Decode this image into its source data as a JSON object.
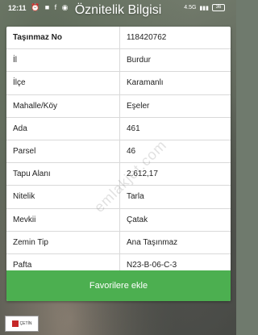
{
  "status_bar": {
    "time": "12:11",
    "icons": "⏰ ■ f ◉",
    "network": "4.5G",
    "battery": "36"
  },
  "header": {
    "title": "Öznitelik Bilgisi"
  },
  "attributes": [
    {
      "key": "Taşınmaz No",
      "value": "118420762"
    },
    {
      "key": "İl",
      "value": "Burdur"
    },
    {
      "key": "İlçe",
      "value": "Karamanlı"
    },
    {
      "key": "Mahalle/Köy",
      "value": "Eşeler"
    },
    {
      "key": "Ada",
      "value": "461"
    },
    {
      "key": "Parsel",
      "value": "46"
    },
    {
      "key": "Tapu Alanı",
      "value": "2.612,17"
    },
    {
      "key": "Nitelik",
      "value": "Tarla"
    },
    {
      "key": "Mevkii",
      "value": "Çatak"
    },
    {
      "key": "Zemin Tip",
      "value": "Ana Taşınmaz"
    },
    {
      "key": "Pafta",
      "value": "N23-B-06-C-3"
    }
  ],
  "favorite_button": {
    "label": "Favorilere ekle",
    "color": "#4caf50"
  },
  "watermark": "emlakjet.com",
  "logo_text": "ÇETİN"
}
